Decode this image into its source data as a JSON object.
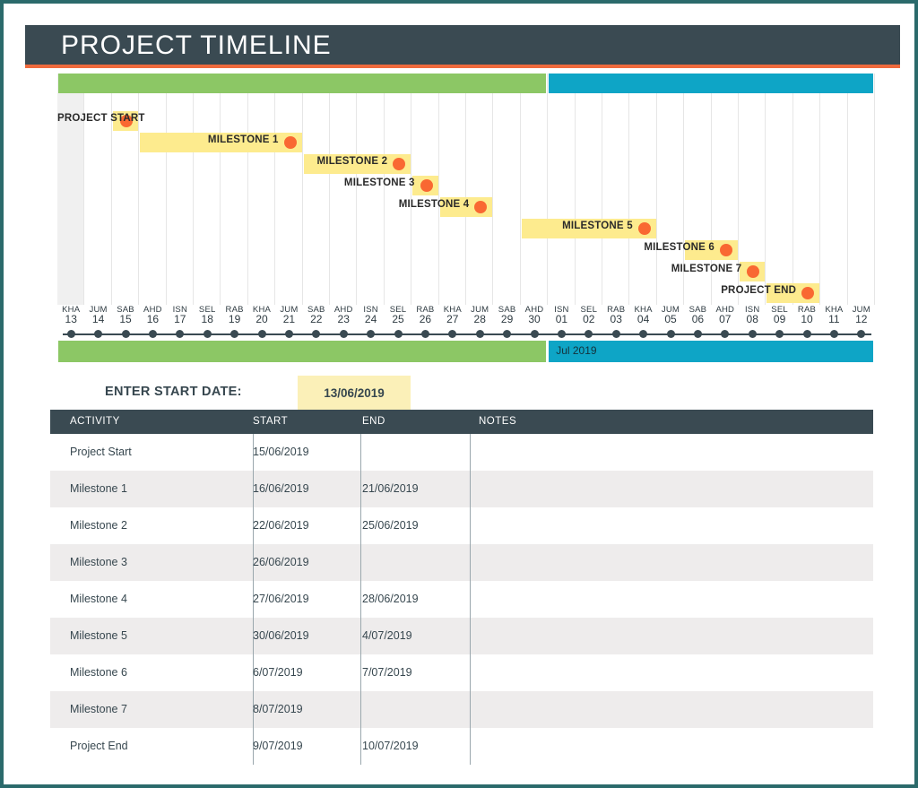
{
  "header": {
    "title": "PROJECT TIMELINE",
    "accent_color": "#ef6a3d",
    "bar_color": "#3a4a52"
  },
  "chart": {
    "colors": {
      "green": "#8cc765",
      "blue": "#0ea5c6",
      "milestone_bar": "#fdeb8e",
      "milestone_dot": "#f96832"
    },
    "month_bands": [
      {
        "label": "",
        "color": "green",
        "start_index": 0,
        "span": 18
      },
      {
        "label": "Jul 2019",
        "color": "blue",
        "start_index": 18,
        "span": 12
      }
    ],
    "month_bands_bottom": [
      {
        "label": "",
        "color": "green",
        "start_index": 0,
        "span": 18
      },
      {
        "label": "Jul 2019",
        "color": "blue",
        "start_index": 18,
        "span": 12
      }
    ],
    "axis": {
      "ticks": [
        {
          "dow": "KHA",
          "dom": "13"
        },
        {
          "dow": "JUM",
          "dom": "14"
        },
        {
          "dow": "SAB",
          "dom": "15"
        },
        {
          "dow": "AHD",
          "dom": "16"
        },
        {
          "dow": "ISN",
          "dom": "17"
        },
        {
          "dow": "SEL",
          "dom": "18"
        },
        {
          "dow": "RAB",
          "dom": "19"
        },
        {
          "dow": "KHA",
          "dom": "20"
        },
        {
          "dow": "JUM",
          "dom": "21"
        },
        {
          "dow": "SAB",
          "dom": "22"
        },
        {
          "dow": "AHD",
          "dom": "23"
        },
        {
          "dow": "ISN",
          "dom": "24"
        },
        {
          "dow": "SEL",
          "dom": "25"
        },
        {
          "dow": "RAB",
          "dom": "26"
        },
        {
          "dow": "KHA",
          "dom": "27"
        },
        {
          "dow": "JUM",
          "dom": "28"
        },
        {
          "dow": "SAB",
          "dom": "29"
        },
        {
          "dow": "AHD",
          "dom": "30"
        },
        {
          "dow": "ISN",
          "dom": "01"
        },
        {
          "dow": "SEL",
          "dom": "02"
        },
        {
          "dow": "RAB",
          "dom": "03"
        },
        {
          "dow": "KHA",
          "dom": "04"
        },
        {
          "dow": "JUM",
          "dom": "05"
        },
        {
          "dow": "SAB",
          "dom": "06"
        },
        {
          "dow": "AHD",
          "dom": "07"
        },
        {
          "dow": "ISN",
          "dom": "08"
        },
        {
          "dow": "SEL",
          "dom": "09"
        },
        {
          "dow": "RAB",
          "dom": "10"
        },
        {
          "dow": "KHA",
          "dom": "11"
        },
        {
          "dow": "JUM",
          "dom": "12"
        }
      ]
    },
    "milestones": [
      {
        "label": "PROJECT START",
        "start_index": 2,
        "span": 1,
        "label_side": "left"
      },
      {
        "label": "MILESTONE 1",
        "start_index": 3,
        "span": 6,
        "label_side": "inside"
      },
      {
        "label": "MILESTONE 2",
        "start_index": 9,
        "span": 4,
        "label_side": "inside"
      },
      {
        "label": "MILESTONE 3",
        "start_index": 13,
        "span": 1,
        "label_side": "left"
      },
      {
        "label": "MILESTONE 4",
        "start_index": 14,
        "span": 2,
        "label_side": "inside"
      },
      {
        "label": "MILESTONE 5",
        "start_index": 17,
        "span": 5,
        "label_side": "inside"
      },
      {
        "label": "MILESTONE 6",
        "start_index": 23,
        "span": 2,
        "label_side": "inside"
      },
      {
        "label": "MILESTONE 7",
        "start_index": 25,
        "span": 1,
        "label_side": "left"
      },
      {
        "label": "PROJECT END",
        "start_index": 26,
        "span": 2,
        "label_side": "inside"
      }
    ]
  },
  "chart_data": {
    "type": "bar",
    "title": "PROJECT TIMELINE",
    "xlabel": "",
    "ylabel": "",
    "grid": true,
    "legend": "none",
    "categories": [
      "Project Start",
      "Milestone 1",
      "Milestone 2",
      "Milestone 3",
      "Milestone 4",
      "Milestone 5",
      "Milestone 6",
      "Milestone 7",
      "Project End"
    ],
    "x_tick_labels": [
      "KHA 13",
      "JUM 14",
      "SAB 15",
      "AHD 16",
      "ISN 17",
      "SEL 18",
      "RAB 19",
      "KHA 20",
      "JUM 21",
      "SAB 22",
      "AHD 23",
      "ISN 24",
      "SEL 25",
      "RAB 26",
      "KHA 27",
      "JUM 28",
      "SAB 29",
      "AHD 30",
      "ISN 01",
      "SEL 02",
      "RAB 03",
      "KHA 04",
      "JUM 05",
      "SAB 06",
      "AHD 07",
      "ISN 08",
      "SEL 09",
      "RAB 10",
      "KHA 11",
      "JUM 12"
    ],
    "series": [
      {
        "name": "start_day_index",
        "values": [
          2,
          3,
          9,
          13,
          14,
          17,
          23,
          25,
          26
        ]
      },
      {
        "name": "duration_days",
        "values": [
          1,
          6,
          4,
          1,
          2,
          5,
          2,
          1,
          2
        ]
      }
    ],
    "annotations": [
      "Jul 2019"
    ]
  },
  "start_date": {
    "label": "ENTER START DATE:",
    "value": "13/06/2019"
  },
  "table": {
    "columns": [
      "ACTIVITY",
      "START",
      "END",
      "NOTES"
    ],
    "rows": [
      {
        "activity": "Project Start",
        "start": "15/06/2019",
        "end": "",
        "notes": ""
      },
      {
        "activity": "Milestone 1",
        "start": "16/06/2019",
        "end": "21/06/2019",
        "notes": ""
      },
      {
        "activity": "Milestone 2",
        "start": "22/06/2019",
        "end": "25/06/2019",
        "notes": ""
      },
      {
        "activity": "Milestone 3",
        "start": "26/06/2019",
        "end": "",
        "notes": ""
      },
      {
        "activity": "Milestone 4",
        "start": "27/06/2019",
        "end": "28/06/2019",
        "notes": ""
      },
      {
        "activity": "Milestone 5",
        "start": "30/06/2019",
        "end": "4/07/2019",
        "notes": ""
      },
      {
        "activity": "Milestone 6",
        "start": "6/07/2019",
        "end": "7/07/2019",
        "notes": ""
      },
      {
        "activity": "Milestone 7",
        "start": "8/07/2019",
        "end": "",
        "notes": ""
      },
      {
        "activity": "Project End",
        "start": "9/07/2019",
        "end": "10/07/2019",
        "notes": ""
      }
    ]
  }
}
